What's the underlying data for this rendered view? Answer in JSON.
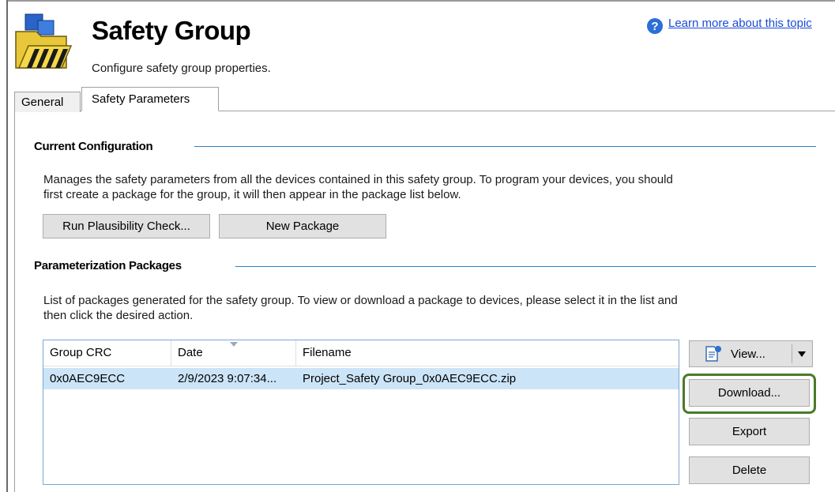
{
  "header": {
    "title": "Safety Group",
    "subtitle": "Configure safety group properties.",
    "help_link": "Learn more about this topic",
    "icon": "folder-hazard-icon"
  },
  "tabs": [
    {
      "label": "General",
      "active": false
    },
    {
      "label": "Safety Parameters",
      "active": true
    }
  ],
  "current_configuration": {
    "title": "Current Configuration",
    "description_line1": "Manages the safety parameters from all the devices contained in this safety group.  To program your devices, you should",
    "description_line2": "first create a package for the group, it will then appear in the package list below.",
    "run_check_label": "Run Plausibility Check...",
    "new_package_label": "New Package"
  },
  "packages": {
    "title": "Parameterization Packages",
    "description_line1": "List of packages generated for the safety group.  To view or download a package to devices, please select it in the list and",
    "description_line2": "then click the desired action.",
    "columns": [
      "Group CRC",
      "Date",
      "Filename"
    ],
    "rows": [
      {
        "crc": "0x0AEC9ECC",
        "date": "2/9/2023 9:07:34...",
        "filename": "Project_Safety Group_0x0AEC9ECC.zip",
        "selected": true
      }
    ],
    "actions": {
      "view_label": "View...",
      "download_label": "Download...",
      "export_label": "Export",
      "delete_label": "Delete"
    }
  },
  "colors": {
    "section_rule": "#2f7fc1",
    "selection": "#cce4f7",
    "highlight": "#4a7a2a",
    "link": "#1a4bd6"
  }
}
